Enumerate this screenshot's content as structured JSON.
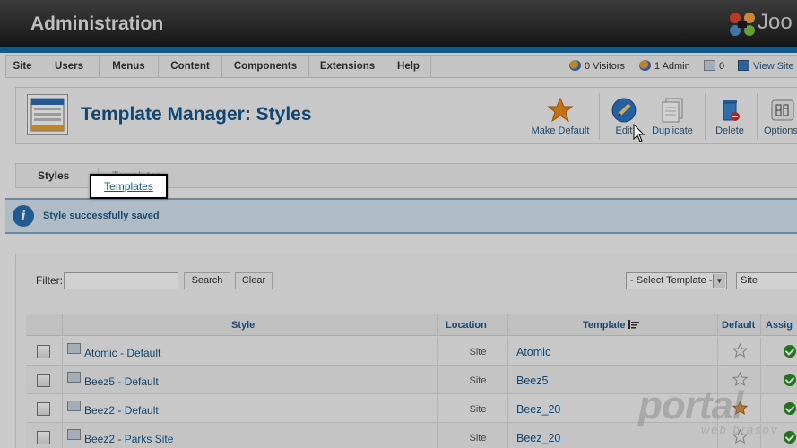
{
  "header": {
    "title": "Administration",
    "logo_text": "Joo"
  },
  "menu": {
    "items": [
      "Site",
      "Users",
      "Menus",
      "Content",
      "Components",
      "Extensions",
      "Help"
    ]
  },
  "status": {
    "visitors": "0 Visitors",
    "admins": "1 Admin",
    "messages": "0",
    "view_site": "View Site"
  },
  "toolbar": {
    "page_title": "Template Manager: Styles",
    "buttons": [
      {
        "label": "Make Default",
        "icon": "star-icon"
      },
      {
        "label": "Edit",
        "icon": "pencil-icon"
      },
      {
        "label": "Duplicate",
        "icon": "duplicate-icon"
      },
      {
        "label": "Delete",
        "icon": "trash-icon"
      },
      {
        "label": "Options",
        "icon": "options-icon"
      }
    ]
  },
  "tabs": {
    "styles": "Styles",
    "templates": "Templates"
  },
  "message": {
    "text": "Style successfully saved"
  },
  "filter": {
    "label": "Filter:",
    "value": "",
    "search_label": "Search",
    "clear_label": "Clear",
    "template_select": "- Select Template -",
    "client_select": "Site"
  },
  "table": {
    "headers": {
      "style": "Style",
      "location": "Location",
      "template": "Template",
      "default": "Default",
      "assigned": "Assig"
    },
    "rows": [
      {
        "style": "Atomic - Default",
        "location": "Site",
        "template": "Atomic",
        "is_default": false
      },
      {
        "style": "Beez5 - Default",
        "location": "Site",
        "template": "Beez5",
        "is_default": false
      },
      {
        "style": "Beez2 - Default",
        "location": "Site",
        "template": "Beez_20",
        "is_default": true
      },
      {
        "style": "Beez2 - Parks Site",
        "location": "Site",
        "template": "Beez_20",
        "is_default": false
      }
    ]
  },
  "watermark": {
    "main": "portal",
    "sub": "web brasov"
  },
  "colors": {
    "brand_blue": "#14568a",
    "header_dark": "#1c1c1c",
    "message_bg": "#d6e6f1",
    "star_gold": "#e8931c"
  }
}
